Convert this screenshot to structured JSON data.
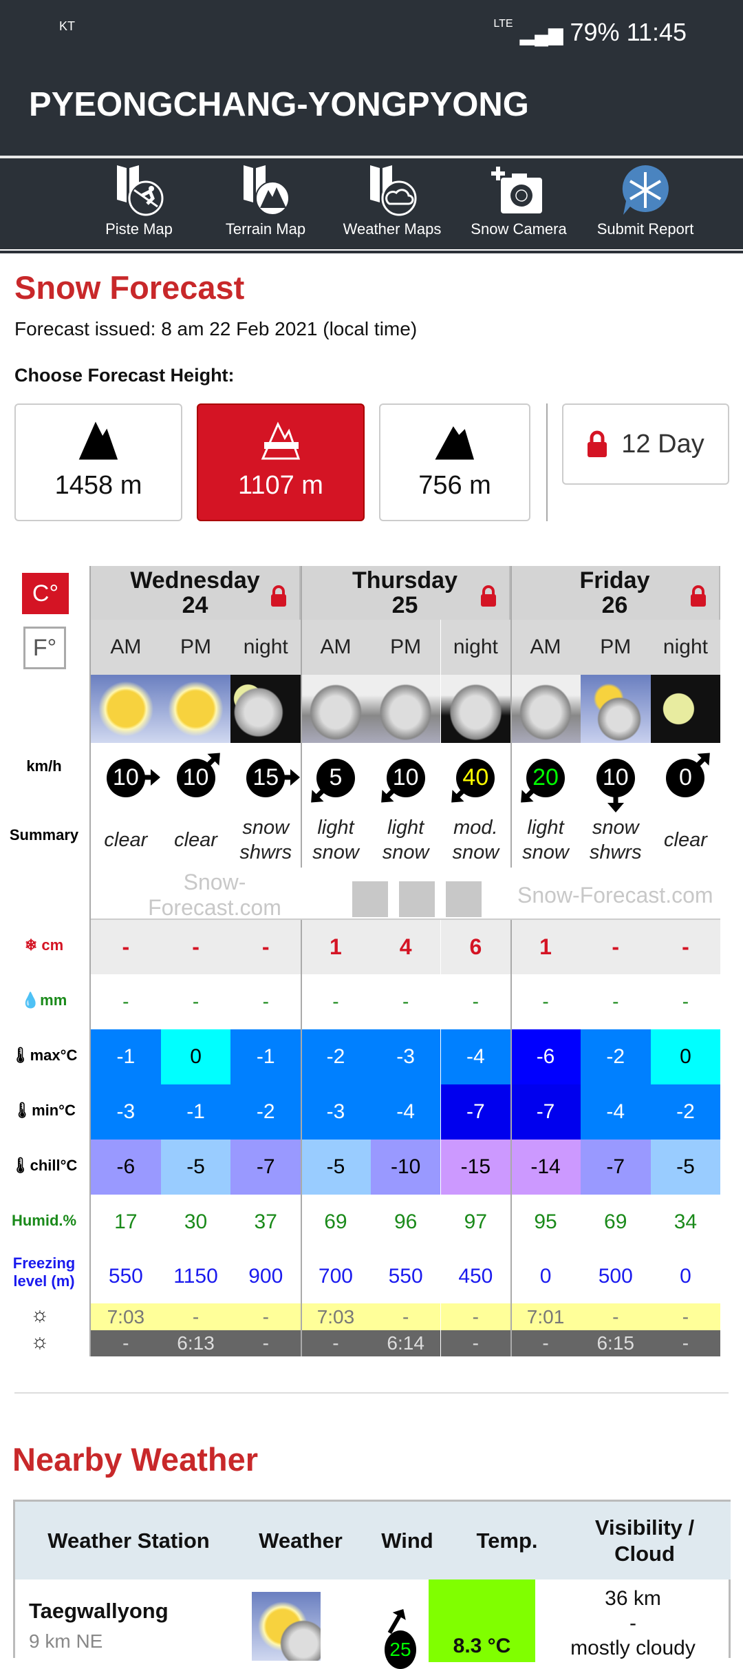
{
  "status_bar": {
    "carrier": "KT",
    "network": "LTE",
    "battery": "79%",
    "time": "11:45"
  },
  "header": {
    "title": "PYEONGCHANG-YONGPYONG"
  },
  "nav": [
    {
      "label": "Piste Map",
      "icon": "piste-map-icon"
    },
    {
      "label": "Terrain Map",
      "icon": "terrain-map-icon"
    },
    {
      "label": "Weather Maps",
      "icon": "weather-maps-icon"
    },
    {
      "label": "Snow Camera",
      "icon": "snow-camera-icon"
    },
    {
      "label": "Submit Report",
      "icon": "snowflake-icon"
    }
  ],
  "forecast": {
    "title": "Snow Forecast",
    "issued": "Forecast issued: 8 am  22 Feb 2021 (local time)",
    "choose_height": "Choose Forecast Height:",
    "heights": [
      {
        "label": "1458 m",
        "selected": false
      },
      {
        "label": "1107 m",
        "selected": true
      },
      {
        "label": "756 m",
        "selected": false
      }
    ],
    "twelve_day": "12 Day",
    "units": {
      "celsius": "C°",
      "fahrenheit": "F°",
      "selected": "C°"
    },
    "labels": {
      "wind": "km/h",
      "summary": "Summary",
      "snow": "cm",
      "rain": "mm",
      "max": "max°C",
      "min": "min°C",
      "chill": "chill°C",
      "humid": "Humid.%",
      "freezing": "Freezing level (m)"
    },
    "watermark": "Snow-Forecast.com",
    "days": [
      {
        "name": "Wednesday",
        "date": "24"
      },
      {
        "name": "Thursday",
        "date": "25"
      },
      {
        "name": "Friday",
        "date": "26"
      }
    ],
    "periods": [
      "AM",
      "PM",
      "night",
      "AM",
      "PM",
      "night",
      "AM",
      "PM",
      "night"
    ],
    "weather": [
      "sunny",
      "sunny",
      "night-partly-cloudy-snow",
      "cloudy-snow",
      "cloudy-snow",
      "night-cloudy-snow",
      "cloudy-snow",
      "partly-cloudy-snow",
      "night-clear"
    ],
    "wind": [
      {
        "speed": "10",
        "dir": "E"
      },
      {
        "speed": "10",
        "dir": "NE"
      },
      {
        "speed": "15",
        "dir": "E"
      },
      {
        "speed": "5",
        "dir": "SW"
      },
      {
        "speed": "10",
        "dir": "SW"
      },
      {
        "speed": "40",
        "dir": "SW",
        "color": "#ffff00"
      },
      {
        "speed": "20",
        "dir": "SW",
        "color": "#00ff00"
      },
      {
        "speed": "10",
        "dir": "S"
      },
      {
        "speed": "0",
        "dir": "NE"
      }
    ],
    "summary": [
      "clear",
      "clear",
      "snow shwrs",
      "light snow",
      "light snow",
      "mod. snow",
      "light snow",
      "snow shwrs",
      "clear"
    ],
    "snow_cm": [
      "-",
      "-",
      "-",
      "1",
      "4",
      "6",
      "1",
      "-",
      "-"
    ],
    "rain_mm": [
      "-",
      "-",
      "-",
      "-",
      "-",
      "-",
      "-",
      "-",
      "-"
    ],
    "max_c": [
      "-1",
      "0",
      "-1",
      "-2",
      "-3",
      "-4",
      "-6",
      "-2",
      "0"
    ],
    "max_colors": [
      "#0080ff",
      "#00ffff",
      "#0080ff",
      "#0080ff",
      "#0080ff",
      "#0080ff",
      "#0000ff",
      "#0080ff",
      "#00ffff"
    ],
    "min_c": [
      "-3",
      "-1",
      "-2",
      "-3",
      "-4",
      "-7",
      "-7",
      "-4",
      "-2"
    ],
    "min_colors": [
      "#0080ff",
      "#0080ff",
      "#0080ff",
      "#0080ff",
      "#0080ff",
      "#0000ee",
      "#0000ee",
      "#0080ff",
      "#0080ff"
    ],
    "chill_c": [
      "-6",
      "-5",
      "-7",
      "-5",
      "-10",
      "-15",
      "-14",
      "-7",
      "-5"
    ],
    "chill_colors": [
      "#9999ff",
      "#99ccff",
      "#9999ff",
      "#99ccff",
      "#9999ff",
      "#cc99ff",
      "#cc99ff",
      "#9999ff",
      "#99ccff"
    ],
    "humidity": [
      "17",
      "30",
      "37",
      "69",
      "96",
      "97",
      "95",
      "69",
      "34"
    ],
    "freezing": [
      "550",
      "1150",
      "900",
      "700",
      "550",
      "450",
      "0",
      "500",
      "0"
    ],
    "sunrise": [
      "7:03",
      "-",
      "-",
      "7:03",
      "-",
      "-",
      "7:01",
      "-",
      "-"
    ],
    "sunset": [
      "-",
      "6:13",
      "-",
      "-",
      "6:14",
      "-",
      "-",
      "6:15",
      "-"
    ]
  },
  "nearby": {
    "title": "Nearby Weather",
    "headers": [
      "Weather Station",
      "Weather",
      "Wind",
      "Temp.",
      "Visibility / Cloud"
    ],
    "rows": [
      {
        "station": "Taegwallyong",
        "distance": "9 km NE",
        "weather": "partly-cloudy",
        "wind": "25",
        "wind_dir": "NE",
        "temp": "8.3 °C",
        "temp_color": "#80ff00",
        "visibility": "36 km",
        "sep": "-",
        "cloud": "mostly cloudy"
      }
    ]
  }
}
